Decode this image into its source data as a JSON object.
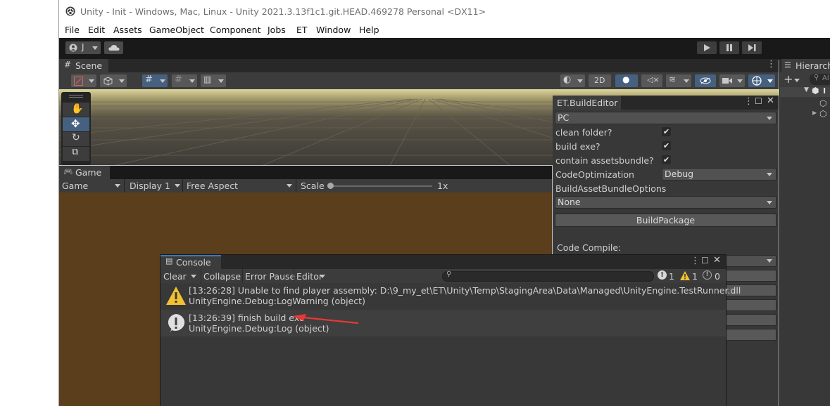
{
  "window": {
    "title": "Unity - Init - Windows, Mac, Linux - Unity 2021.3.13f1c1.git.HEAD.469278 Personal <DX11>"
  },
  "menu": [
    "File",
    "Edit",
    "Assets",
    "GameObject",
    "Component",
    "Jobs",
    "ET",
    "Window",
    "Help"
  ],
  "toolbar": {
    "account_label": "J",
    "play_icon": "play-icon",
    "pause_icon": "pause-icon",
    "step_icon": "step-icon"
  },
  "scene": {
    "tab_label": "Scene",
    "mode_2d": "2D"
  },
  "game": {
    "tab_label": "Game",
    "view_select": "Game",
    "display_select": "Display 1",
    "aspect_select": "Free Aspect",
    "scale_label": "Scale",
    "scale_value": "1x"
  },
  "build_editor": {
    "tab_label": "ET.BuildEditor",
    "platform": "PC",
    "clean_folder_label": "clean folder?",
    "build_exe_label": "build exe?",
    "contain_ab_label": "contain assetsbundle?",
    "clean_folder": "✔",
    "build_exe": "✔",
    "contain_ab": "✔",
    "code_opt_label": "CodeOptimization",
    "code_opt_value": "Debug",
    "ab_options_label": "BuildAssetBundleOptions",
    "ab_options_value": "None",
    "build_button": "BuildPackage",
    "code_compile_label": "Code Compile:"
  },
  "hierarchy": {
    "tab_label": "Hierarch",
    "search_placeholder": "Al"
  },
  "console": {
    "tab_label": "Console",
    "clear": "Clear",
    "collapse": "Collapse",
    "error_pause": "Error Pause",
    "editor": "Editor",
    "count_log": "1",
    "count_warn": "1",
    "count_error": "0",
    "entries": [
      {
        "line1": "[13:26:28] Unable to find player assembly: D:\\9_my_et\\ET\\Unity\\Temp\\StagingArea\\Data\\Managed\\UnityEngine.TestRunner.dll",
        "line2": "UnityEngine.Debug:LogWarning (object)",
        "icon": "warning-icon"
      },
      {
        "line1": "[13:26:39] finish build exe",
        "line2": "UnityEngine.Debug:Log (object)",
        "icon": "info-icon"
      }
    ]
  },
  "colors": {
    "annotation_arrow": "#e53935",
    "game_view_bg": "#5b3e1b"
  }
}
